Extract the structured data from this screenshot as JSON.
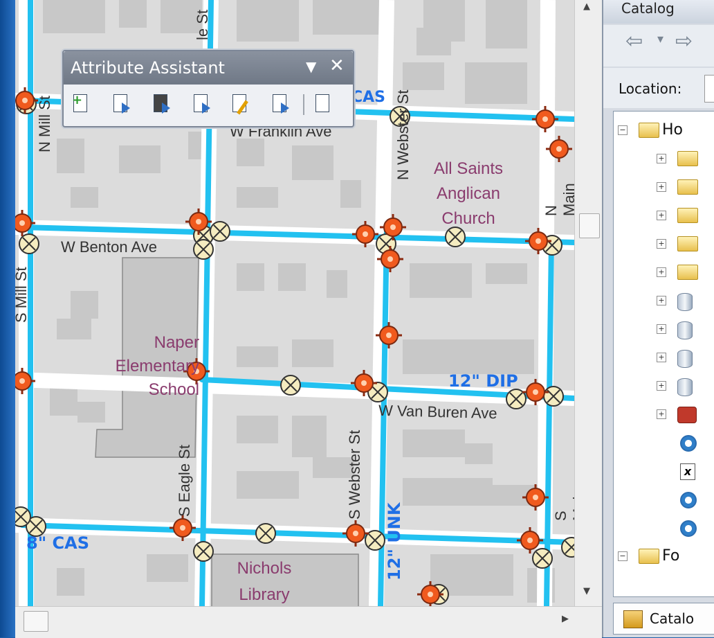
{
  "map": {
    "streets": [
      "N Mill St",
      "W Franklin Ave",
      "N Webster St",
      "N Main St",
      "W Benton Ave",
      "S Mill St",
      "W Van Buren Ave",
      "S Eagle St",
      "S Webster St",
      "S Main St",
      "le St"
    ],
    "places": [
      {
        "lines": [
          "All Saints",
          "Anglican",
          "Church"
        ]
      },
      {
        "lines": [
          "Naper",
          "Elementary",
          "School"
        ]
      },
      {
        "lines": [
          "Nichols",
          "Library"
        ]
      }
    ],
    "pipe_labels": [
      "CAS",
      "12\" DIP",
      "8\" CAS",
      "12\" UNK"
    ],
    "colors": {
      "water_main": "#22c1f0",
      "pipe_label": "#1f6fe6",
      "hydrant": "#f05a1e",
      "valve": "#f5ecc0",
      "place_label": "#8a3c6e"
    }
  },
  "attribute_assistant": {
    "title": "Attribute Assistant",
    "dropdown_icon": "chevron-down-icon",
    "close_icon": "close-icon",
    "tools": [
      "add-feature-icon",
      "copy-feature-icon",
      "copy-features-icon",
      "run-change-icon",
      "run-manual-icon",
      "transfer-icon",
      "settings-icon"
    ]
  },
  "catalog": {
    "title": "Catalog",
    "location_label": "Location:",
    "tree": [
      {
        "label": "Ho",
        "icon": "home-folder-icon",
        "expander": "minus"
      },
      {
        "label": "",
        "icon": "folder-icon",
        "expander": "plus"
      },
      {
        "label": "",
        "icon": "folder-icon",
        "expander": "plus"
      },
      {
        "label": "",
        "icon": "folder-icon",
        "expander": "plus"
      },
      {
        "label": "",
        "icon": "folder-icon",
        "expander": "plus"
      },
      {
        "label": "",
        "icon": "folder-icon",
        "expander": "plus"
      },
      {
        "label": "",
        "icon": "database-icon",
        "expander": "plus"
      },
      {
        "label": "",
        "icon": "database-icon",
        "expander": "plus"
      },
      {
        "label": "",
        "icon": "database-icon",
        "expander": "plus"
      },
      {
        "label": "",
        "icon": "database-icon",
        "expander": "plus"
      },
      {
        "label": "",
        "icon": "toolbox-icon",
        "expander": "plus"
      },
      {
        "label": "",
        "icon": "query-icon",
        "expander": ""
      },
      {
        "label": "",
        "icon": "xml-icon",
        "expander": ""
      },
      {
        "label": "",
        "icon": "query-icon",
        "expander": ""
      },
      {
        "label": "",
        "icon": "query-icon",
        "expander": ""
      },
      {
        "label": "Fo",
        "icon": "folder-icon",
        "expander": "minus"
      }
    ],
    "tab_label": "Catalo"
  }
}
